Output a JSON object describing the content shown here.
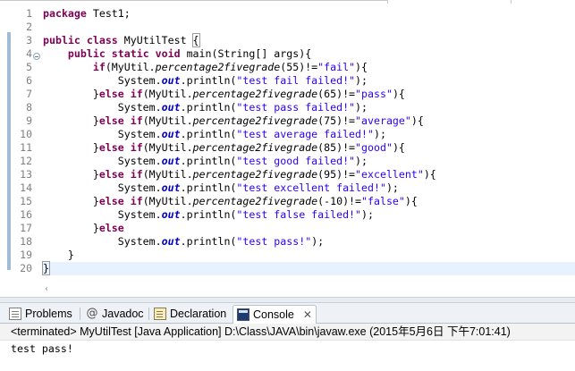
{
  "editor": {
    "lines": [
      "1",
      "2",
      "3",
      "4",
      "5",
      "6",
      "7",
      "8",
      "9",
      "10",
      "11",
      "12",
      "13",
      "14",
      "15",
      "16",
      "17",
      "18",
      "19",
      "20"
    ],
    "code": {
      "l1": [
        "package",
        " Test1;"
      ],
      "l3": [
        "public",
        " ",
        "class",
        " MyUtilTest ",
        "{"
      ],
      "l4": [
        "public",
        " ",
        "static",
        " ",
        "void",
        " main(String[] args){"
      ],
      "l5": [
        "if",
        "(MyUtil.",
        "percentage2fivegrade",
        "(55)!=",
        "\"fail\"",
        "){"
      ],
      "l6": [
        "System.",
        "out",
        ".println(",
        "\"test fail failed!\"",
        ");"
      ],
      "l7": [
        "}",
        "else",
        " ",
        "if",
        "(MyUtil.",
        "percentage2fivegrade",
        "(65)!=",
        "\"pass\"",
        "){"
      ],
      "l8": [
        "System.",
        "out",
        ".println(",
        "\"test pass failed!\"",
        ");"
      ],
      "l9": [
        "}",
        "else",
        " ",
        "if",
        "(MyUtil.",
        "percentage2fivegrade",
        "(75)!=",
        "\"average\"",
        "){"
      ],
      "l10": [
        "System.",
        "out",
        ".println(",
        "\"test average failed!\"",
        ");"
      ],
      "l11": [
        "}",
        "else",
        " ",
        "if",
        "(MyUtil.",
        "percentage2fivegrade",
        "(85)!=",
        "\"good\"",
        "){"
      ],
      "l12": [
        "System.",
        "out",
        ".println(",
        "\"test good failed!\"",
        ");"
      ],
      "l13": [
        "}",
        "else",
        " ",
        "if",
        "(MyUtil.",
        "percentage2fivegrade",
        "(95)!=",
        "\"excellent\"",
        "){"
      ],
      "l14": [
        "System.",
        "out",
        ".println(",
        "\"test excellent failed!\"",
        ");"
      ],
      "l15": [
        "}",
        "else",
        " ",
        "if",
        "(MyUtil.",
        "percentage2fivegrade",
        "(-10)!=",
        "\"false\"",
        "){"
      ],
      "l16": [
        "System.",
        "out",
        ".println(",
        "\"test false failed!\"",
        ");"
      ],
      "l17": [
        "}",
        "else"
      ],
      "l18": [
        "System.",
        "out",
        ".println(",
        "\"test pass!\"",
        ");"
      ],
      "l19": [
        "}"
      ],
      "l20": [
        "}"
      ]
    }
  },
  "tabs": [
    {
      "label": "Problems",
      "icon": "problems-icon"
    },
    {
      "label": "Javadoc",
      "icon": "at-icon",
      "glyph": "@"
    },
    {
      "label": "Declaration",
      "icon": "declaration-icon"
    },
    {
      "label": "Console",
      "icon": "console-icon",
      "close": "✕"
    }
  ],
  "console": {
    "header": "<terminated> MyUtilTest [Java Application] D:\\Class\\JAVA\\bin\\javaw.exe (2015年5月6日 下午7:01:41)",
    "output": "test pass!"
  },
  "scroll_arrow": "‹"
}
